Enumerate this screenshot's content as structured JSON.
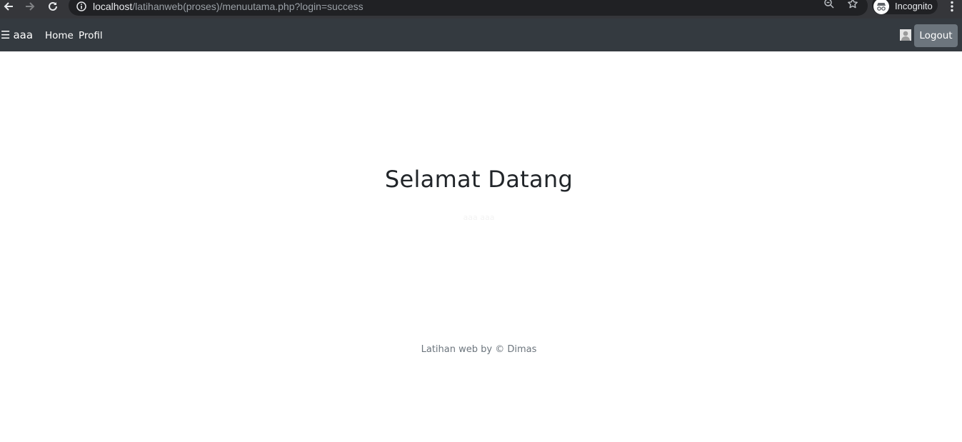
{
  "browser": {
    "url_host": "localhost",
    "url_path": "/latihanweb(proses)/menuutama.php?login=success",
    "profile_label": "Incognito",
    "icons": [
      "back-icon",
      "forward-icon",
      "reload-icon",
      "info-icon",
      "zoom-icon",
      "star-icon",
      "incognito-icon",
      "more-icon"
    ]
  },
  "navbar": {
    "brand_icon": "☰",
    "brand_label": "aaa",
    "links": [
      "Home",
      "Profil"
    ],
    "logout_label": "Logout",
    "colors": {
      "background": "#343a40",
      "button": "#6c757d"
    }
  },
  "main": {
    "title": "Selamat Datang",
    "username": "aaa aaa"
  },
  "footer": {
    "text": "Latihan web by © Dimas"
  }
}
